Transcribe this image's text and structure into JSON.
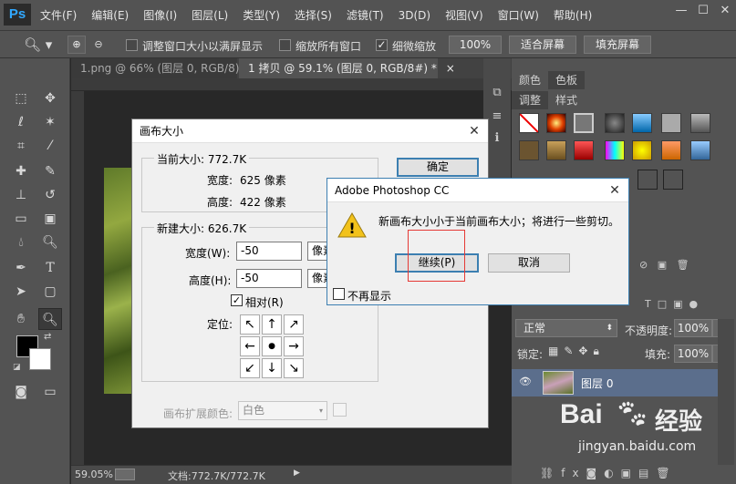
{
  "app": {
    "logo": "Ps"
  },
  "menu": [
    "文件(F)",
    "编辑(E)",
    "图像(I)",
    "图层(L)",
    "类型(Y)",
    "选择(S)",
    "滤镜(T)",
    "3D(D)",
    "视图(V)",
    "窗口(W)",
    "帮助(H)"
  ],
  "window_controls": {
    "minimize": "—",
    "restore": "☐",
    "close": "✕"
  },
  "options": {
    "fit_window": "调整窗口大小以满屏显示",
    "zoom_all": "缩放所有窗口",
    "scrubby_zoom": "细微缩放",
    "zoom_100": "100%",
    "fit_screen": "适合屏幕",
    "fill_screen": "填充屏幕"
  },
  "tabs": [
    {
      "label": "1.png @ 66% (图层 0, RGB/8)",
      "close": "×"
    },
    {
      "label": "1 拷贝 @ 59.1% (图层 0, RGB/8#) *",
      "close": "×"
    }
  ],
  "status": {
    "zoom": "59.05%",
    "doc": "文档:772.7K/772.7K"
  },
  "panels": {
    "top_tabs": [
      "颜色",
      "色板"
    ],
    "style_tabs": [
      "调整",
      "样式"
    ],
    "blend_mode": "正常",
    "opacity_label": "不透明度:",
    "opacity_value": "100%",
    "lock_label": "锁定:",
    "fill_label": "填充:",
    "fill_value": "100%",
    "layer_name": "图层 0"
  },
  "canvas_dialog": {
    "title": "画布大小",
    "current_label": "当前大小: 772.7K",
    "width_label": "宽度:",
    "width_value": "625 像素",
    "height_label": "高度:",
    "height_value": "422 像素",
    "new_label": "新建大小: 626.7K",
    "new_width_label": "宽度(W):",
    "new_width_value": "-50",
    "new_height_label": "高度(H):",
    "new_height_value": "-50",
    "unit": "像素",
    "relative_label": "相对(R)",
    "anchor_label": "定位:",
    "ext_color_label": "画布扩展颜色:",
    "ext_color_value": "白色",
    "ok": "确定",
    "anchor_glyphs": [
      "↖",
      "↑",
      "↗",
      "←",
      "●",
      "→",
      "↙",
      "↓",
      "↘"
    ]
  },
  "alert": {
    "title": "Adobe Photoshop CC",
    "message": "新画布大小小于当前画布大小；将进行一些剪切。",
    "continue": "继续(P)",
    "cancel": "取消",
    "dont_show": "不再显示",
    "close": "✕",
    "warning_icon_glyph": "!"
  },
  "watermark": {
    "brand": "Bai",
    "brand_suffix": "经验",
    "url": "jingyan.baidu.com"
  },
  "colors": {
    "accent": "#3c7fb1",
    "warning": "#f2c21b",
    "highlight_box": "#e53935"
  }
}
